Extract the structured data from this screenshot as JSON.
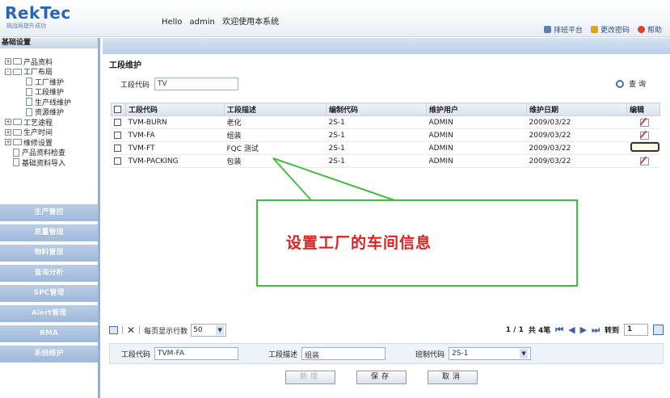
{
  "header": {
    "logo": "RekTec",
    "logo_sub": "挑战局提升成功",
    "greeting": [
      "Hello",
      "admin",
      "欢迎使用本系统"
    ],
    "links": [
      "排班平台",
      "更改密码",
      "帮助"
    ]
  },
  "sidebar": {
    "title": "基础设置",
    "tree": [
      {
        "label": "产品资料",
        "level": 1,
        "toggle": "+"
      },
      {
        "label": "工厂布局",
        "level": 1,
        "toggle": "-"
      },
      {
        "label": "工厂维护",
        "level": 2
      },
      {
        "label": "工段维护",
        "level": 2
      },
      {
        "label": "生产线维护",
        "level": 2
      },
      {
        "label": "资源维护",
        "level": 2
      },
      {
        "label": "工艺途程",
        "level": 1,
        "toggle": "+"
      },
      {
        "label": "生产时间",
        "level": 1,
        "toggle": "+"
      },
      {
        "label": "维修设置",
        "level": 1,
        "toggle": "+"
      },
      {
        "label": "产品资料检查",
        "level": 1,
        "toggle": ""
      },
      {
        "label": "基础资料导入",
        "level": 1,
        "toggle": ""
      }
    ],
    "nav": [
      "生产管控",
      "质量管理",
      "物料管理",
      "查询分析",
      "SPC管理",
      "Alert管理",
      "RMA",
      "系统维护"
    ]
  },
  "main": {
    "title": "工段维护",
    "search": {
      "label": "工段代码",
      "value": "TV",
      "button": "查 询"
    },
    "columns": [
      "工段代码",
      "工段描述",
      "编制代码",
      "维护用户",
      "维护日期",
      "编辑"
    ],
    "rows": [
      {
        "code": "TVM-BURN",
        "desc": "老化",
        "org": "2S-1",
        "user": "ADMIN",
        "date": "2009/03/22"
      },
      {
        "code": "TVM-FA",
        "desc": "组装",
        "org": "2S-1",
        "user": "ADMIN",
        "date": "2009/03/22"
      },
      {
        "code": "TVM-FT",
        "desc": "FQC 测试",
        "org": "2S-1",
        "user": "ADMIN",
        "date": "2009/03/22"
      },
      {
        "code": "TVM-PACKING",
        "desc": "包装",
        "org": "2S-1",
        "user": "ADMIN",
        "date": "2009/03/22"
      }
    ],
    "callout": "设置工厂的车间信息",
    "pager": {
      "per_page_label": "每页显示行数",
      "per_page": "50",
      "page": "1 / 1",
      "total": "共 4笔",
      "goto_label": "转到",
      "goto_value": "1"
    },
    "form": {
      "code_label": "工段代码",
      "code_value": "TVM-FA",
      "desc_label": "工段描述",
      "desc_value": "组装",
      "org_label": "班制代码",
      "org_value": "2S-1"
    },
    "buttons": {
      "new": "新增",
      "save": "保存",
      "cancel": "取消"
    }
  },
  "colors": {
    "accent": "#2a66b5",
    "nav_button": "#a9c1e1",
    "callout_border": "#3fbf3f",
    "callout_text": "#e02020"
  }
}
